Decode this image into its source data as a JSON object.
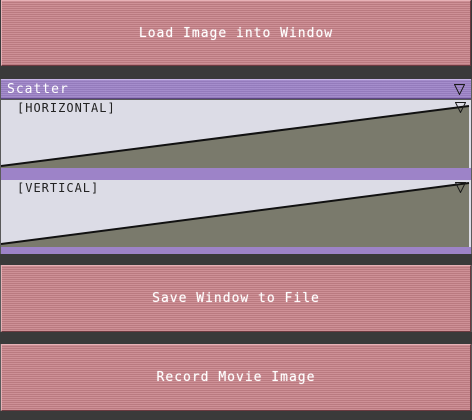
{
  "buttons": {
    "load_image": "Load Image into Window",
    "save_window": "Save Window to File",
    "record_movie": "Record Movie Image"
  },
  "selector": {
    "value": "Scatter",
    "icon": "triangle-down-icon"
  },
  "graphs": {
    "horizontal": {
      "label": "[HORIZONTAL]",
      "icon": "triangle-down-icon",
      "curve": "linear-ramp"
    },
    "vertical": {
      "label": "[VERTICAL]",
      "icon": "triangle-down-icon",
      "curve": "linear-ramp"
    }
  },
  "colors": {
    "button": "#c8838a",
    "selector": "#9d83c8",
    "graph_background": "#dcdce6",
    "graph_fill": "#7a7a6c",
    "separator": "#3a3a3a"
  }
}
